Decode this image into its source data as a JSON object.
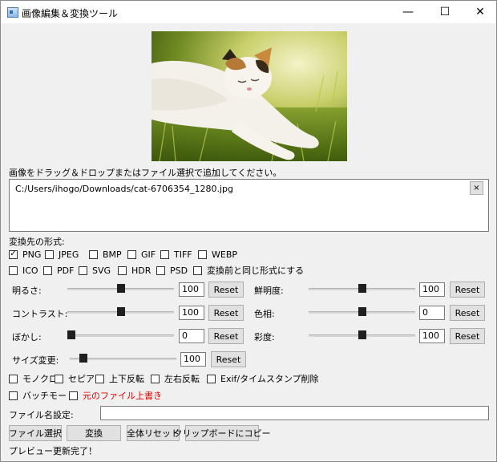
{
  "window": {
    "title": "画像編集＆変換ツール",
    "minimize": "—",
    "maximize": "☐",
    "close": "✕"
  },
  "drop_label": "画像をドラッグ＆ドロップまたはファイル選択で追加してください。",
  "file_list": {
    "path": "C:/Users/ihogo/Downloads/cat-6706354_1280.jpg",
    "remove_label": "×"
  },
  "format_label": "変換先の形式:",
  "formats_row1": [
    {
      "label": "PNG",
      "checked": true
    },
    {
      "label": "JPEG",
      "checked": false
    },
    {
      "label": "BMP",
      "checked": false
    },
    {
      "label": "GIF",
      "checked": false
    },
    {
      "label": "TIFF",
      "checked": false
    },
    {
      "label": "WEBP",
      "checked": false
    }
  ],
  "formats_row2": [
    {
      "label": "ICO",
      "checked": false
    },
    {
      "label": "PDF",
      "checked": false
    },
    {
      "label": "SVG",
      "checked": false
    },
    {
      "label": "HDR",
      "checked": false
    },
    {
      "label": "PSD",
      "checked": false
    },
    {
      "label": "変換前と同じ形式にする",
      "checked": false
    }
  ],
  "adjustments": [
    {
      "label": "明るさ:",
      "value": "100",
      "level": 0.5,
      "reset": "Reset"
    },
    {
      "label": "鮮明度:",
      "value": "100",
      "level": 0.5,
      "reset": "Reset"
    },
    {
      "label": "コントラスト:",
      "value": "100",
      "level": 0.5,
      "reset": "Reset"
    },
    {
      "label": "色相:",
      "value": "0",
      "level": 0.5,
      "reset": "Reset"
    },
    {
      "label": "ぼかし:",
      "value": "0",
      "level": 0.0,
      "reset": "Reset"
    },
    {
      "label": "彩度:",
      "value": "100",
      "level": 0.5,
      "reset": "Reset"
    },
    {
      "label": "サイズ変更:",
      "value": "100",
      "level": 0.1,
      "reset": "Reset"
    }
  ],
  "options_row1": [
    {
      "label": "モノクロ",
      "checked": false
    },
    {
      "label": "セピア",
      "checked": false
    },
    {
      "label": "上下反転",
      "checked": false
    },
    {
      "label": "左右反転",
      "checked": false
    },
    {
      "label": "Exif/タイムスタンプ削除",
      "checked": false
    }
  ],
  "options_row2": [
    {
      "label": "バッチモード",
      "checked": false
    },
    {
      "label": "元のファイル上書き",
      "checked": false
    }
  ],
  "filename": {
    "label": "ファイル名設定:",
    "value": ""
  },
  "buttons": {
    "select_file": "ファイル選択",
    "convert": "変換",
    "reset_all": "全体リセット",
    "copy_clipboard": "クリップボードにコピー"
  },
  "status": "プレビュー更新完了！",
  "colors": {
    "overwrite_label": "#e00000"
  }
}
